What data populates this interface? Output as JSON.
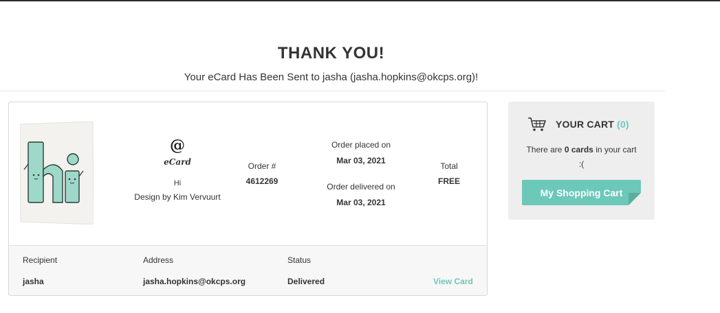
{
  "page": {
    "heading": "THANK YOU!",
    "subheading": "Your eCard Has Been Sent to jasha (jasha.hopkins@okcps.org)!"
  },
  "order": {
    "type_icon": "at-icon",
    "type_label": "eCard",
    "card_title": "Hi",
    "designer": "Design by Kim Vervuurt",
    "order_number_label": "Order #",
    "order_number": "4612269",
    "placed_label": "Order placed on",
    "placed_date": "Mar 03, 2021",
    "delivered_label": "Order delivered on",
    "delivered_date": "Mar 03, 2021",
    "total_label": "Total",
    "total_value": "FREE",
    "thumbnail_icon": "hi-card-thumbnail",
    "accent_color": "#9ed8c8"
  },
  "delivery": {
    "recipient_label": "Recipient",
    "recipient": "jasha",
    "address_label": "Address",
    "address": "jasha.hopkins@okcps.org",
    "status_label": "Status",
    "status": "Delivered",
    "view_link": "View Card"
  },
  "cart": {
    "icon": "shopping-cart-icon",
    "title": "YOUR CART",
    "count": "(0)",
    "text_before": "There are",
    "count_text": "0 cards",
    "text_after": "in your cart",
    "face": ":(",
    "button_label": "My Shopping Cart",
    "accent_color": "#6cc8b8"
  }
}
